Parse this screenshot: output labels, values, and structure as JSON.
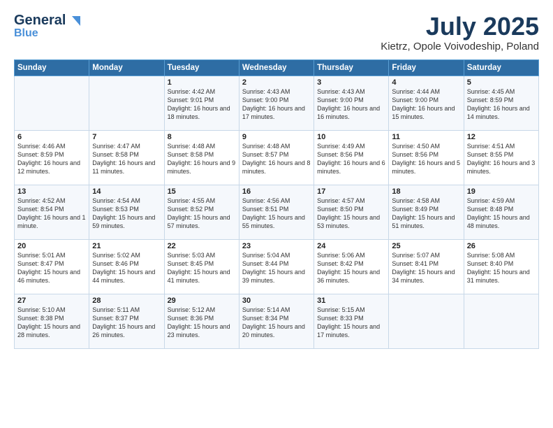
{
  "header": {
    "logo_general": "General",
    "logo_blue": "Blue",
    "title": "July 2025",
    "subtitle": "Kietrz, Opole Voivodeship, Poland"
  },
  "days_of_week": [
    "Sunday",
    "Monday",
    "Tuesday",
    "Wednesday",
    "Thursday",
    "Friday",
    "Saturday"
  ],
  "weeks": [
    [
      {
        "day": "",
        "content": ""
      },
      {
        "day": "",
        "content": ""
      },
      {
        "day": "1",
        "content": "Sunrise: 4:42 AM\nSunset: 9:01 PM\nDaylight: 16 hours and 18 minutes."
      },
      {
        "day": "2",
        "content": "Sunrise: 4:43 AM\nSunset: 9:00 PM\nDaylight: 16 hours and 17 minutes."
      },
      {
        "day": "3",
        "content": "Sunrise: 4:43 AM\nSunset: 9:00 PM\nDaylight: 16 hours and 16 minutes."
      },
      {
        "day": "4",
        "content": "Sunrise: 4:44 AM\nSunset: 9:00 PM\nDaylight: 16 hours and 15 minutes."
      },
      {
        "day": "5",
        "content": "Sunrise: 4:45 AM\nSunset: 8:59 PM\nDaylight: 16 hours and 14 minutes."
      }
    ],
    [
      {
        "day": "6",
        "content": "Sunrise: 4:46 AM\nSunset: 8:59 PM\nDaylight: 16 hours and 12 minutes."
      },
      {
        "day": "7",
        "content": "Sunrise: 4:47 AM\nSunset: 8:58 PM\nDaylight: 16 hours and 11 minutes."
      },
      {
        "day": "8",
        "content": "Sunrise: 4:48 AM\nSunset: 8:58 PM\nDaylight: 16 hours and 9 minutes."
      },
      {
        "day": "9",
        "content": "Sunrise: 4:48 AM\nSunset: 8:57 PM\nDaylight: 16 hours and 8 minutes."
      },
      {
        "day": "10",
        "content": "Sunrise: 4:49 AM\nSunset: 8:56 PM\nDaylight: 16 hours and 6 minutes."
      },
      {
        "day": "11",
        "content": "Sunrise: 4:50 AM\nSunset: 8:56 PM\nDaylight: 16 hours and 5 minutes."
      },
      {
        "day": "12",
        "content": "Sunrise: 4:51 AM\nSunset: 8:55 PM\nDaylight: 16 hours and 3 minutes."
      }
    ],
    [
      {
        "day": "13",
        "content": "Sunrise: 4:52 AM\nSunset: 8:54 PM\nDaylight: 16 hours and 1 minute."
      },
      {
        "day": "14",
        "content": "Sunrise: 4:54 AM\nSunset: 8:53 PM\nDaylight: 15 hours and 59 minutes."
      },
      {
        "day": "15",
        "content": "Sunrise: 4:55 AM\nSunset: 8:52 PM\nDaylight: 15 hours and 57 minutes."
      },
      {
        "day": "16",
        "content": "Sunrise: 4:56 AM\nSunset: 8:51 PM\nDaylight: 15 hours and 55 minutes."
      },
      {
        "day": "17",
        "content": "Sunrise: 4:57 AM\nSunset: 8:50 PM\nDaylight: 15 hours and 53 minutes."
      },
      {
        "day": "18",
        "content": "Sunrise: 4:58 AM\nSunset: 8:49 PM\nDaylight: 15 hours and 51 minutes."
      },
      {
        "day": "19",
        "content": "Sunrise: 4:59 AM\nSunset: 8:48 PM\nDaylight: 15 hours and 48 minutes."
      }
    ],
    [
      {
        "day": "20",
        "content": "Sunrise: 5:01 AM\nSunset: 8:47 PM\nDaylight: 15 hours and 46 minutes."
      },
      {
        "day": "21",
        "content": "Sunrise: 5:02 AM\nSunset: 8:46 PM\nDaylight: 15 hours and 44 minutes."
      },
      {
        "day": "22",
        "content": "Sunrise: 5:03 AM\nSunset: 8:45 PM\nDaylight: 15 hours and 41 minutes."
      },
      {
        "day": "23",
        "content": "Sunrise: 5:04 AM\nSunset: 8:44 PM\nDaylight: 15 hours and 39 minutes."
      },
      {
        "day": "24",
        "content": "Sunrise: 5:06 AM\nSunset: 8:42 PM\nDaylight: 15 hours and 36 minutes."
      },
      {
        "day": "25",
        "content": "Sunrise: 5:07 AM\nSunset: 8:41 PM\nDaylight: 15 hours and 34 minutes."
      },
      {
        "day": "26",
        "content": "Sunrise: 5:08 AM\nSunset: 8:40 PM\nDaylight: 15 hours and 31 minutes."
      }
    ],
    [
      {
        "day": "27",
        "content": "Sunrise: 5:10 AM\nSunset: 8:38 PM\nDaylight: 15 hours and 28 minutes."
      },
      {
        "day": "28",
        "content": "Sunrise: 5:11 AM\nSunset: 8:37 PM\nDaylight: 15 hours and 26 minutes."
      },
      {
        "day": "29",
        "content": "Sunrise: 5:12 AM\nSunset: 8:36 PM\nDaylight: 15 hours and 23 minutes."
      },
      {
        "day": "30",
        "content": "Sunrise: 5:14 AM\nSunset: 8:34 PM\nDaylight: 15 hours and 20 minutes."
      },
      {
        "day": "31",
        "content": "Sunrise: 5:15 AM\nSunset: 8:33 PM\nDaylight: 15 hours and 17 minutes."
      },
      {
        "day": "",
        "content": ""
      },
      {
        "day": "",
        "content": ""
      }
    ]
  ]
}
